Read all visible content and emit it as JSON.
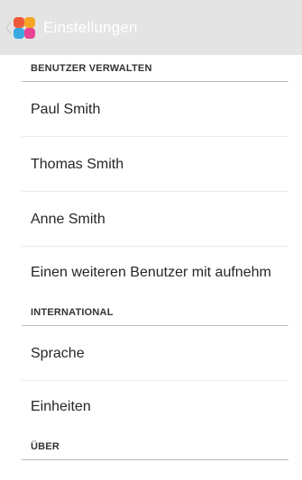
{
  "action_bar": {
    "icon": "colorful-pinwheel-app-icon",
    "icon_colors": [
      "#f05a3c",
      "#f6a623",
      "#3aa9e0",
      "#e84393"
    ],
    "title": "Einstellungen"
  },
  "sections": [
    {
      "header": "BENUTZER VERWALTEN",
      "items": [
        "Paul Smith",
        "Thomas Smith",
        "Anne Smith",
        "Einen weiteren Benutzer mit aufnehm"
      ]
    },
    {
      "header": "INTERNATIONAL",
      "items": [
        "Sprache",
        "Einheiten"
      ]
    },
    {
      "header": "ÜBER",
      "items": []
    }
  ]
}
